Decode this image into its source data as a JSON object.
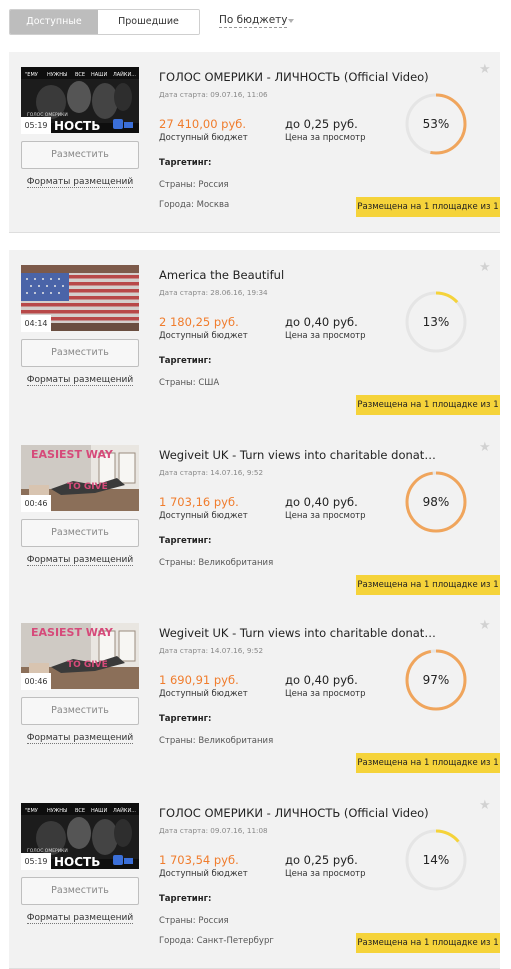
{
  "tabs": {
    "active": "Доступные",
    "inactive": "Прошедшие"
  },
  "sort_label": "По бюджету",
  "colors": {
    "accent": "#f07c2c",
    "badge": "#f5d33a",
    "ring_track": "#e5e5e5",
    "ring_progress_high": "#f0a55c",
    "ring_progress_low": "#f5d33a"
  },
  "common": {
    "place_button": "Разместить",
    "formats_link": "Форматы размещений",
    "budget_label": "Доступный бюджет",
    "price_label": "Цена за просмотр",
    "targeting_label": "Таргетинг:",
    "star_icon": "star-icon"
  },
  "campaigns": [
    {
      "title": "ГОЛОС ОМЕРИКИ - ЛИЧНОСТЬ (Official Video)",
      "date": "Дата старта: 09.07.16, 11:06",
      "duration": "05:19",
      "budget": "27 410,00 руб.",
      "price": "до 0,25 руб.",
      "percent": 53,
      "percent_label": "53%",
      "line1": "Страны: Россия",
      "line2": "Города: Москва",
      "badge": "Размещена на 1 площадке из 1",
      "thumb": "band-photo"
    },
    {
      "title": "America the Beautiful",
      "date": "Дата старта: 28.06.16, 19:34",
      "duration": "04:14",
      "budget": "2 180,25 руб.",
      "price": "до 0,40 руб.",
      "percent": 13,
      "percent_label": "13%",
      "line1": "Страны: США",
      "line2": "",
      "badge": "Размещена на 1 площадке из 1",
      "thumb": "flag-photo"
    },
    {
      "title": "Wegiveit UK - Turn views into charitable donations",
      "date": "Дата старта: 14.07.16, 9:52",
      "duration": "00:46",
      "budget": "1 703,16 руб.",
      "price": "до 0,40 руб.",
      "percent": 98,
      "percent_label": "98%",
      "line1": "Страны: Великобритания",
      "line2": "",
      "badge": "Размещена на 1 площадке из 1",
      "thumb": "room-photo",
      "thumb_text_top": "EASIEST WAY",
      "thumb_text_bottom": "TO GIVE"
    },
    {
      "title": "Wegiveit UK - Turn views into charitable donations",
      "date": "Дата старта: 14.07.16, 9:52",
      "duration": "00:46",
      "budget": "1 690,91 руб.",
      "price": "до 0,40 руб.",
      "percent": 97,
      "percent_label": "97%",
      "line1": "Страны: Великобритания",
      "line2": "",
      "badge": "Размещена на 1 площадке из 1",
      "thumb": "room-photo",
      "thumb_text_top": "EASIEST WAY",
      "thumb_text_bottom": "TO GIVE"
    },
    {
      "title": "ГОЛОС ОМЕРИКИ - ЛИЧНОСТЬ (Official Video)",
      "date": "Дата старта: 09.07.16, 11:08",
      "duration": "05:19",
      "budget": "1 703,54 руб.",
      "price": "до 0,25 руб.",
      "percent": 14,
      "percent_label": "14%",
      "line1": "Страны: Россия",
      "line2": "Города: Санкт-Петербург",
      "badge": "Размещена на 1 площадке из 1",
      "thumb": "band-photo"
    }
  ],
  "band_thumb_text": {
    "top_row": [
      "\"ЕМУ",
      "НУЖНЫ",
      "ВСЕ",
      "НАШИ",
      "ЛАЙКИ..."
    ],
    "caption": "ГОЛОС ОМЕРИКИ",
    "big": "НОСТЬ"
  }
}
